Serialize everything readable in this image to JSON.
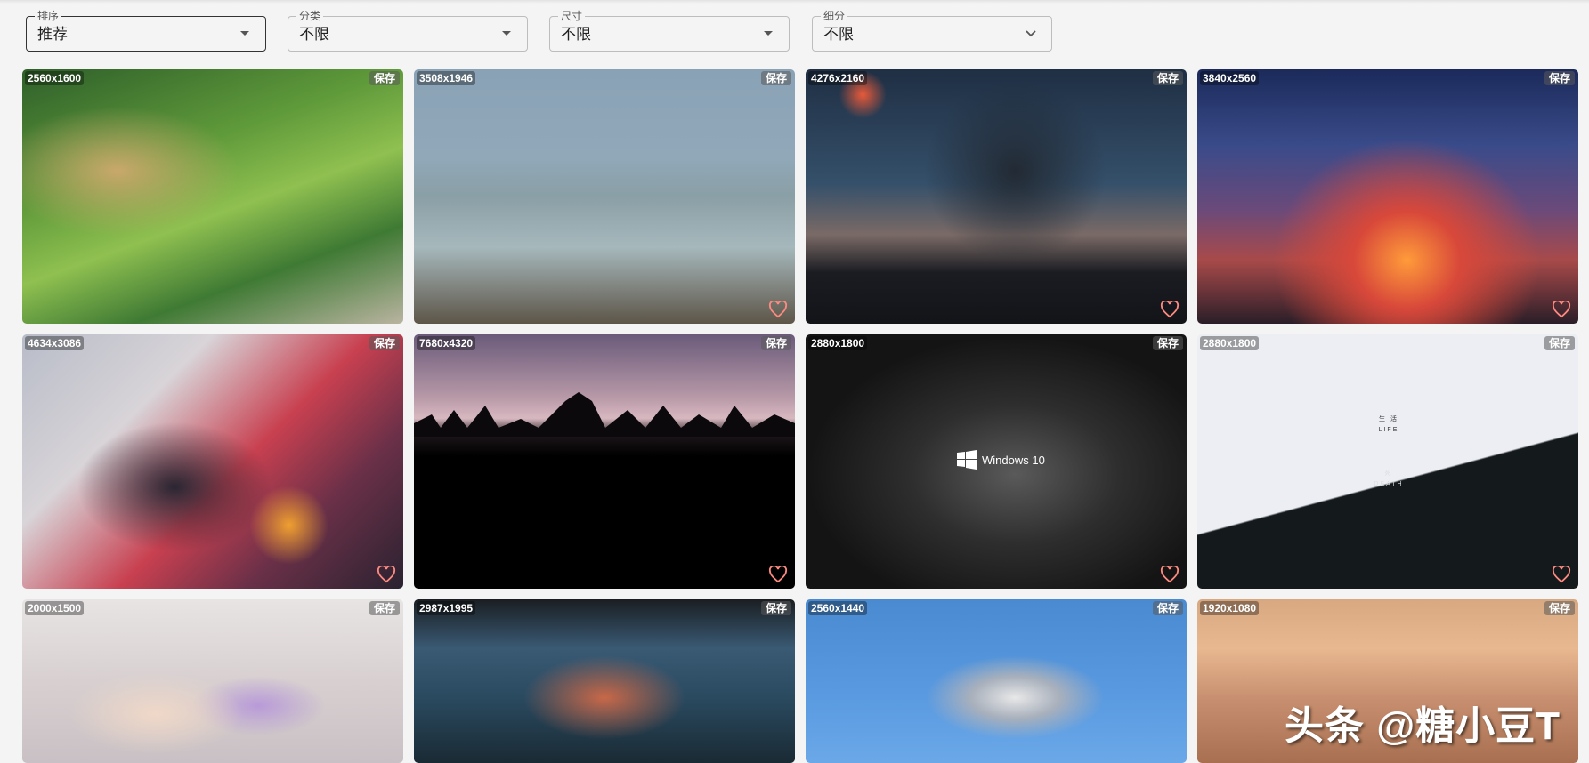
{
  "filters": [
    {
      "label": "排序",
      "value": "推荐"
    },
    {
      "label": "分类",
      "value": "不限"
    },
    {
      "label": "尺寸",
      "value": "不限"
    },
    {
      "label": "细分",
      "value": "不限"
    }
  ],
  "save_label": "保存",
  "cards": [
    {
      "resolution": "2560x1600"
    },
    {
      "resolution": "3508x1946"
    },
    {
      "resolution": "4276x2160"
    },
    {
      "resolution": "3840x2560"
    },
    {
      "resolution": "4634x3086"
    },
    {
      "resolution": "7680x4320"
    },
    {
      "resolution": "2880x1800",
      "overlay_text": "Windows 10"
    },
    {
      "resolution": "2880x1800",
      "overlay_text_top": "生 活",
      "overlay_text_life": "LIFE",
      "overlay_text_mid": "死",
      "overlay_text_death": "DEATH"
    },
    {
      "resolution": "2000x1500"
    },
    {
      "resolution": "2987x1995"
    },
    {
      "resolution": "2560x1440"
    },
    {
      "resolution": "1920x1080"
    }
  ],
  "watermark": "头条 @糖小豆T",
  "colors": {
    "heart": "#ff8a80",
    "background": "#f4f4f4"
  }
}
